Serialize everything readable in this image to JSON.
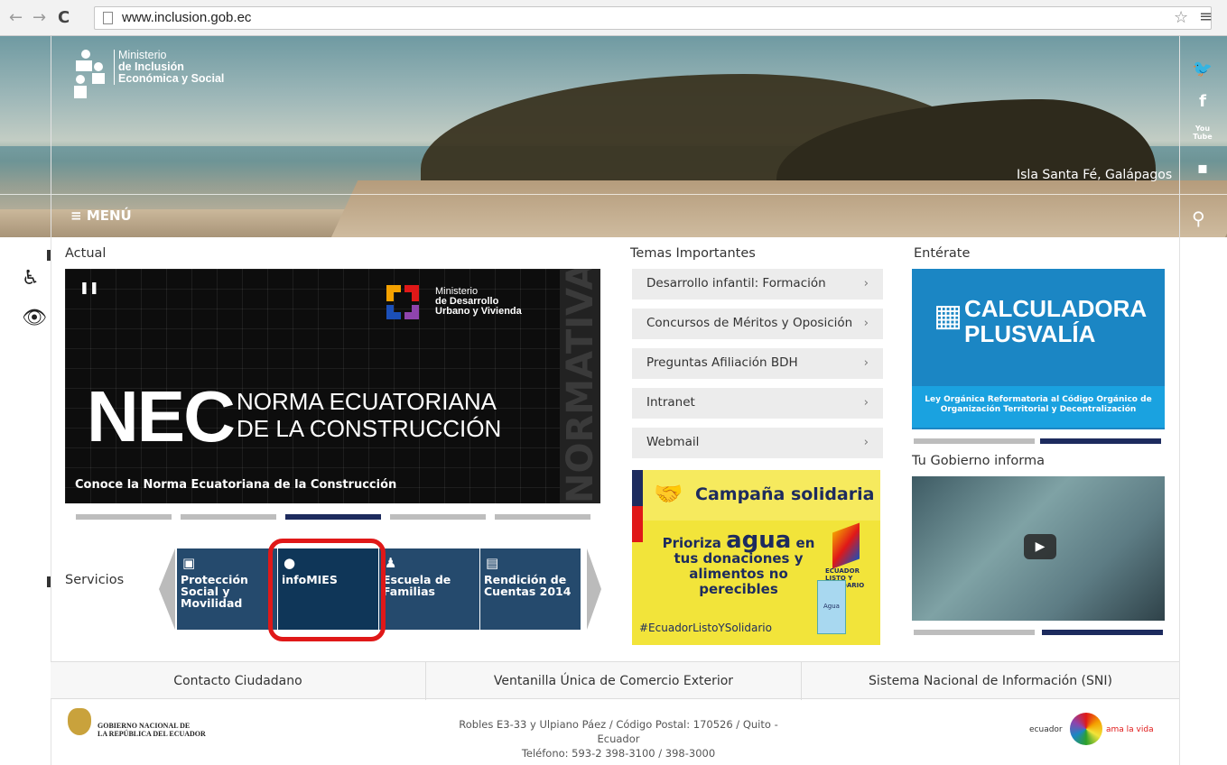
{
  "browser": {
    "url": "www.inclusion.gob.ec"
  },
  "header": {
    "logo_line1": "Ministerio",
    "logo_line2": "de Inclusión",
    "logo_line3": "Económica y Social",
    "location": "Isla Santa Fé, Galápagos",
    "menu_label": "MENÚ"
  },
  "social": [
    {
      "name": "twitter-icon",
      "glyph": "🐦"
    },
    {
      "name": "facebook-icon",
      "glyph": "f"
    },
    {
      "name": "youtube-icon",
      "glyph": "You Tube"
    },
    {
      "name": "flickr-icon",
      "glyph": "••"
    }
  ],
  "actual": {
    "title": "Actual",
    "slide": {
      "ministry_line1": "Ministerio",
      "ministry_line2": "de Desarrollo",
      "ministry_line3": "Urbano y Vivienda",
      "big": "NEC",
      "subtitle_line1": "NORMA ECUATORIANA",
      "subtitle_line2": "DE LA CONSTRUCCIÓN",
      "side": "NORMATIVA OFICIAL",
      "caption": "Conoce la Norma Ecuatoriana de la Construcción"
    }
  },
  "servicios": {
    "title": "Servicios",
    "items": [
      {
        "label": "Protección Social y Movilidad"
      },
      {
        "label": "infoMIES"
      },
      {
        "label": "Escuela de Familias"
      },
      {
        "label": "Rendición de Cuentas 2014"
      }
    ]
  },
  "temas": {
    "title": "Temas Importantes",
    "items": [
      "Desarrollo infantil: Formación",
      "Concursos de Méritos y Oposición",
      "Preguntas Afiliación BDH",
      "Intranet",
      "Webmail"
    ],
    "chevron": "›"
  },
  "campaign": {
    "title": "Campaña solidaria",
    "line1": "Prioriza",
    "line_big": "agua",
    "line1b": "en",
    "line2": "tus donaciones y",
    "line3": "alimentos no perecibles",
    "badge": "ECUADOR LISTO Y SOLIDARIO",
    "agua_label": "Agua",
    "hashtag": "#EcuadorListoYSolidario"
  },
  "enterate": {
    "title": "Entérate",
    "calc_line1": "CALCULADORA",
    "calc_line2": "PLUSVALÍA",
    "calc_foot": "Ley Orgánica Reformatoria al Código Orgánico de Organización Territorial y Decentralización"
  },
  "gobierno": {
    "title": "Tu Gobierno informa"
  },
  "footer": {
    "links": [
      "Contacto Ciudadano",
      "Ventanilla Única de Comercio Exterior",
      "Sistema Nacional de Información (SNI)"
    ],
    "gob_line1": "GOBIERNO NACIONAL DE",
    "gob_line2": "LA REPÚBLICA DEL ECUADOR",
    "address": "Robles E3-33 y Ulpiano Páez / Código Postal: 170526 / Quito - Ecuador",
    "phone": "Teléfono: 593-2 398-3100 / 398-3000",
    "ecuador": "ecuador",
    "ama": "ama la vida"
  }
}
